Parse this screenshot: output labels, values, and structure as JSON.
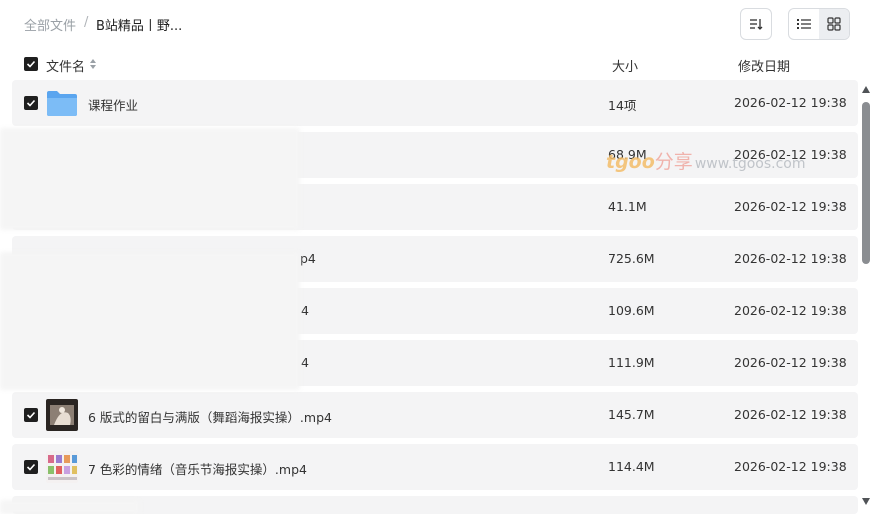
{
  "breadcrumb": {
    "root": "全部文件",
    "separator": "/",
    "current": "B站精品丨野..."
  },
  "toolbar": {
    "sort_icon": "sort-icon",
    "list_view_icon": "list-view-icon",
    "grid_view_icon": "grid-view-icon",
    "active_view": "grid"
  },
  "columns": {
    "name": "文件名",
    "size": "大小",
    "date": "修改日期"
  },
  "rows": [
    {
      "name": "课程作业",
      "size": "14项",
      "date": "2026-02-12 19:38",
      "type": "folder",
      "checked": true
    },
    {
      "name": "",
      "size": "68.9M",
      "date": "2026-02-12 19:38",
      "type": "video",
      "checked": true
    },
    {
      "name": "",
      "size": "41.1M",
      "date": "2026-02-12 19:38",
      "type": "video",
      "checked": true
    },
    {
      "name": "p4",
      "size": "725.6M",
      "date": "2026-02-12 19:38",
      "type": "video",
      "checked": true
    },
    {
      "name": "4",
      "size": "109.6M",
      "date": "2026-02-12 19:38",
      "type": "video",
      "checked": true
    },
    {
      "name": "4",
      "size": "111.9M",
      "date": "2026-02-12 19:38",
      "type": "video",
      "checked": true
    },
    {
      "name": "6 版式的留白与满版（舞蹈海报实操）.mp4",
      "size": "145.7M",
      "date": "2026-02-12 19:38",
      "type": "video",
      "checked": true
    },
    {
      "name": "7 色彩的情绪（音乐节海报实操）.mp4",
      "size": "114.4M",
      "date": "2026-02-12 19:38",
      "type": "video",
      "checked": true
    }
  ],
  "watermark": {
    "logo": "tgoo",
    "brand": "分享",
    "url": "www.tgoos.com"
  },
  "colors": {
    "row_bg": "#f4f4f5",
    "checkbox": "#1f1f1f",
    "folder": "#6fb3f4",
    "text_muted": "#9aa0a6"
  }
}
